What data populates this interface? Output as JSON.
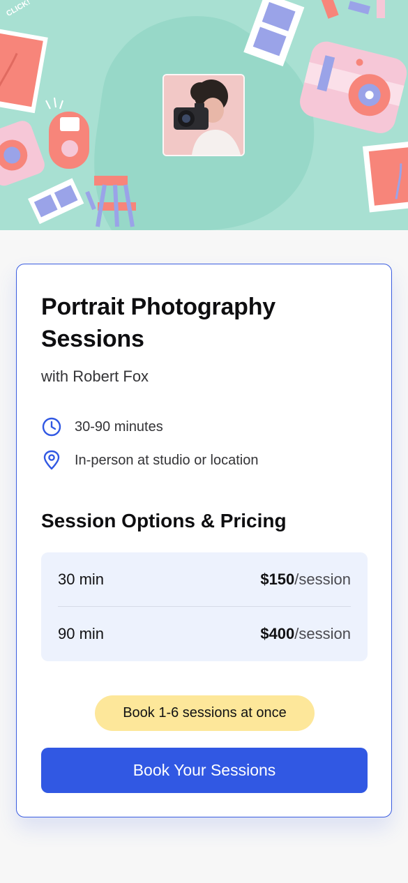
{
  "hero": {
    "sticker_text": "CLICK!",
    "colors": {
      "background": "#a8e0d2",
      "blob": "#97d8c8",
      "coral": "#f7857a",
      "pink": "#f6c7d7",
      "lavender": "#9aa3e8"
    }
  },
  "offering": {
    "title": "Portrait Photography Sessions",
    "subtitle": "with Robert Fox",
    "details": [
      {
        "icon": "clock-icon",
        "text": "30-90 minutes"
      },
      {
        "icon": "location-pin-icon",
        "text": "In-person at studio or location"
      }
    ]
  },
  "pricing": {
    "heading": "Session Options & Pricing",
    "options": [
      {
        "duration": "30 min",
        "price": "$150",
        "unit": "/session"
      },
      {
        "duration": "90 min",
        "price": "$400",
        "unit": "/session"
      }
    ]
  },
  "badge": {
    "text": "Book 1-6 sessions at once"
  },
  "cta": {
    "label": "Book Your Sessions"
  },
  "colors": {
    "accent": "#3158e3",
    "card_border": "#3a5ce0",
    "pricing_bg": "#edf2fd",
    "badge_bg": "#fde79a"
  }
}
